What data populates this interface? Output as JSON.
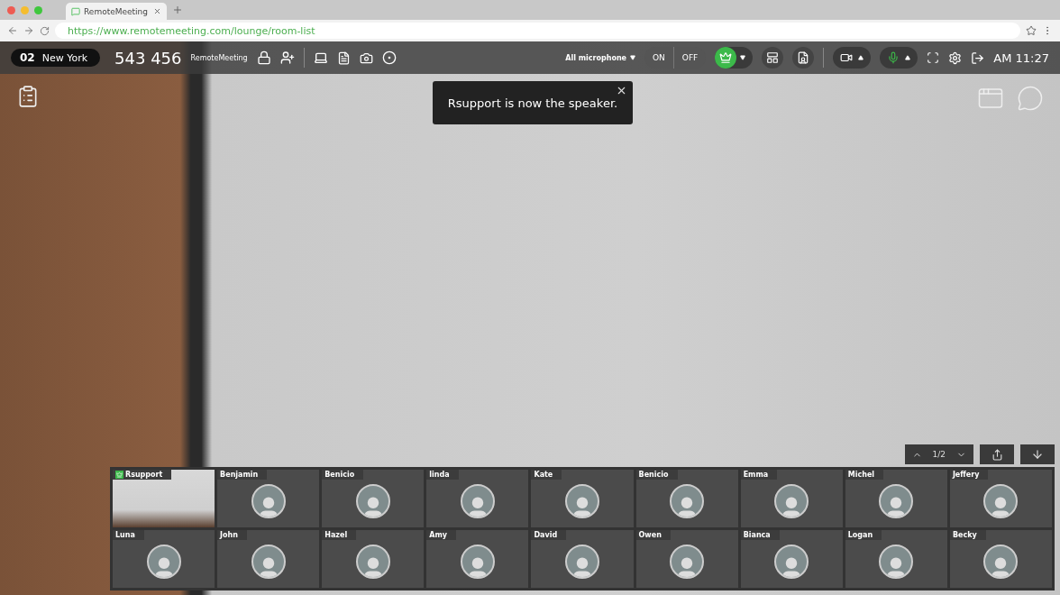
{
  "browser": {
    "tab_title": "RemoteMeeting",
    "url": "https://www.remotemeeting.com/lounge/room-list"
  },
  "toolbar": {
    "room_number": "02",
    "room_name": "New York",
    "meeting_code": "543 456",
    "app_name": "RemoteMeeting",
    "microphone_label": "All microphone",
    "mic_toggle": [
      "ON",
      "OFF"
    ],
    "speaker_mode_on": true,
    "mic_on": true,
    "time": "AM 11:27"
  },
  "toast": {
    "message": "Rsupport is now the speaker."
  },
  "pager": {
    "page": "1/2"
  },
  "participants": [
    {
      "name": "Rsupport",
      "speaker": true,
      "video": true
    },
    {
      "name": "Benjamin",
      "speaker": false,
      "video": false
    },
    {
      "name": "Benicio",
      "speaker": false,
      "video": false
    },
    {
      "name": "linda",
      "speaker": false,
      "video": false
    },
    {
      "name": "Kate",
      "speaker": false,
      "video": false
    },
    {
      "name": "Benicio",
      "speaker": false,
      "video": false
    },
    {
      "name": "Emma",
      "speaker": false,
      "video": false
    },
    {
      "name": "Michel",
      "speaker": false,
      "video": false
    },
    {
      "name": "Jeffery",
      "speaker": false,
      "video": false
    },
    {
      "name": "Luna",
      "speaker": false,
      "video": false
    },
    {
      "name": "John",
      "speaker": false,
      "video": false
    },
    {
      "name": "Hazel",
      "speaker": false,
      "video": false
    },
    {
      "name": "Amy",
      "speaker": false,
      "video": false
    },
    {
      "name": "David",
      "speaker": false,
      "video": false
    },
    {
      "name": "Owen",
      "speaker": false,
      "video": false
    },
    {
      "name": "Bianca",
      "speaker": false,
      "video": false
    },
    {
      "name": "Logan",
      "speaker": false,
      "video": false
    },
    {
      "name": "Becky",
      "speaker": false,
      "video": false
    }
  ]
}
